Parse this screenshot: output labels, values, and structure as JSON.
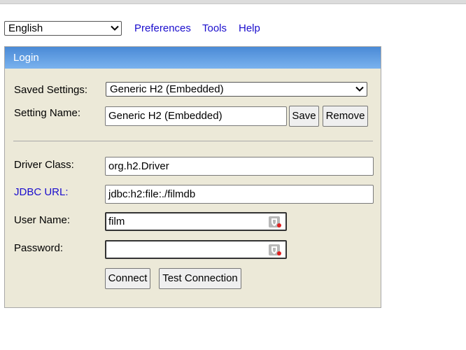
{
  "language_select": {
    "value": "English"
  },
  "nav": {
    "preferences": "Preferences",
    "tools": "Tools",
    "help": "Help"
  },
  "panel": {
    "title": "Login",
    "saved_settings": {
      "label": "Saved Settings:",
      "value": "Generic H2 (Embedded)"
    },
    "setting_name": {
      "label": "Setting Name:",
      "value": "Generic H2 (Embedded)"
    },
    "save_label": "Save",
    "remove_label": "Remove",
    "driver_class": {
      "label": "Driver Class:",
      "value": "org.h2.Driver"
    },
    "jdbc_url": {
      "label": "JDBC URL:",
      "value": "jdbc:h2:file:./filmdb"
    },
    "user_name": {
      "label": "User Name:",
      "value": "film"
    },
    "password": {
      "label": "Password:",
      "value": ""
    },
    "connect_label": "Connect",
    "test_connection_label": "Test Connection"
  },
  "colors": {
    "header_start": "#4a8ad6",
    "header_end": "#7ab2ee",
    "panel_bg": "#ece9d8",
    "link": "#1a0dcd"
  },
  "icons": {
    "select_arrow": "chevron-down-icon",
    "password_manager": "password-manager-icon"
  }
}
